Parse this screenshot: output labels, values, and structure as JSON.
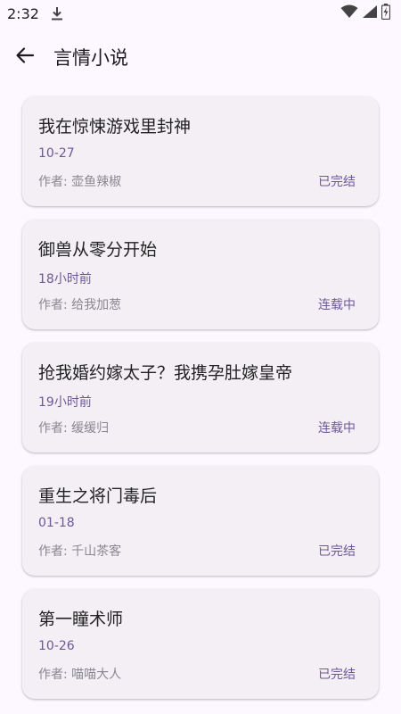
{
  "status_bar": {
    "time": "2:32",
    "icons": [
      "download-icon",
      "wifi-icon",
      "signal-icon",
      "battery-icon"
    ]
  },
  "app_bar": {
    "title": "言情小说",
    "back_icon": "arrow-left-icon"
  },
  "novels": [
    {
      "title": "我在惊悚游戏里封神",
      "time": "10-27",
      "author": "作者: 壶鱼辣椒",
      "status": "已完结"
    },
    {
      "title": "御兽从零分开始",
      "time": "18小时前",
      "author": "作者: 给我加葱",
      "status": "连载中"
    },
    {
      "title": "抢我婚约嫁太子？我携孕肚嫁皇帝",
      "time": "19小时前",
      "author": "作者: 缓缓归",
      "status": "连载中"
    },
    {
      "title": "重生之将门毒后",
      "time": "01-18",
      "author": "作者: 千山茶客",
      "status": "已完结"
    },
    {
      "title": "第一瞳术师",
      "time": "10-26",
      "author": "作者: 喵喵大人",
      "status": "已完结"
    }
  ],
  "colors": {
    "background": "#fdf7ff",
    "card": "#f3eff5",
    "accent": "#6b5a98",
    "muted": "#8a8790"
  }
}
